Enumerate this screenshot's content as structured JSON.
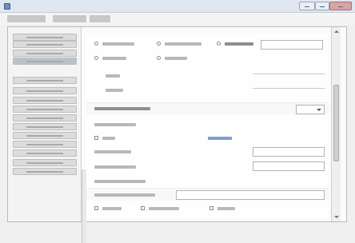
{
  "window": {
    "title": "",
    "buttons": {
      "minimize_icon": "minimize-icon",
      "maximize_icon": "maximize-icon",
      "close_icon": "close-icon"
    }
  },
  "menu": {
    "tabs": [
      "",
      "",
      ""
    ]
  },
  "sidebar": {
    "items": [
      {
        "label": "",
        "selected": false
      },
      {
        "label": "",
        "selected": false
      },
      {
        "label": "",
        "selected": false
      },
      {
        "label": "",
        "selected": true
      },
      {
        "label": "",
        "selected": false
      },
      {
        "label": "",
        "selected": false
      },
      {
        "label": "",
        "selected": false
      },
      {
        "label": "",
        "selected": false
      },
      {
        "label": "",
        "selected": false
      },
      {
        "label": "",
        "selected": false
      },
      {
        "label": "",
        "selected": false
      },
      {
        "label": "",
        "selected": false
      },
      {
        "label": "",
        "selected": false
      },
      {
        "label": "",
        "selected": false
      },
      {
        "label": "",
        "selected": false
      }
    ]
  },
  "form": {
    "radio_group_1": [
      {
        "label": ""
      },
      {
        "label": ""
      },
      {
        "label": ""
      }
    ],
    "radio_group_2": [
      {
        "label": ""
      },
      {
        "label": ""
      }
    ],
    "static_labels": [
      "",
      ""
    ],
    "dropdown_label": "",
    "dropdown_value": "",
    "section_label": "",
    "toggle_label": "",
    "link_text": "",
    "field_1": {
      "label": "",
      "value": ""
    },
    "field_2": {
      "label": "",
      "value": ""
    },
    "field_3": {
      "label": ""
    },
    "field_4": {
      "label": ""
    },
    "bottom_checks": [
      {
        "label": ""
      },
      {
        "label": ""
      },
      {
        "label": ""
      }
    ]
  }
}
